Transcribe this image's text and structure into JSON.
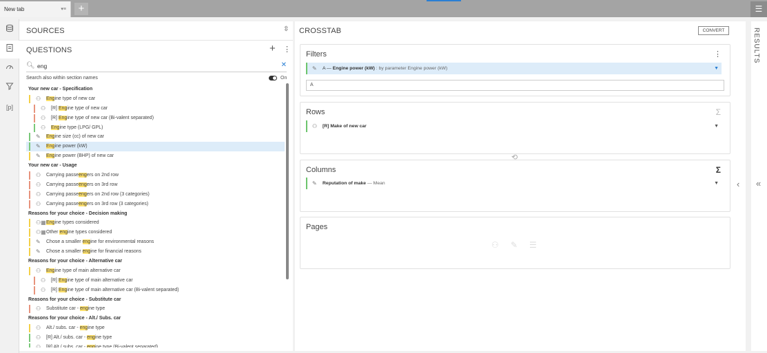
{
  "tabs": [
    {
      "label": "New tab",
      "icon": "tab-options-icon"
    }
  ],
  "new_tab_label": "+",
  "sidebar_icons": [
    "database-icon",
    "clipboard-icon",
    "gauge-icon",
    "filter-icon",
    "parameter-icon"
  ],
  "parameter_glyph": "[p]",
  "sources": {
    "title": "SOURCES"
  },
  "questions": {
    "title": "QUESTIONS",
    "search_value": "eng",
    "search_option": "Search also within section names",
    "toggle_label": "On",
    "items": [
      {
        "type": "section",
        "text": "Your new car - Specification"
      },
      {
        "indent": 1,
        "bar": "#f3d046",
        "icon": "multi",
        "pre": "",
        "hl": "Eng",
        "post": "ine type of new car"
      },
      {
        "indent": 2,
        "bar": "#e7937c",
        "icon": "multi",
        "pre": "[R] ",
        "hl": "Eng",
        "post": "ine type of new car"
      },
      {
        "indent": 2,
        "bar": "#e7937c",
        "icon": "multi",
        "pre": "[R] ",
        "hl": "Eng",
        "post": "ine type of new car (Bi-valent separated)"
      },
      {
        "indent": 2,
        "bar": "#79c879",
        "icon": "multi",
        "pre": "",
        "hl": "Eng",
        "post": "ine type (LPG/ GPL)"
      },
      {
        "indent": 1,
        "bar": "#79c879",
        "icon": "ruler",
        "pre": "",
        "hl": "Eng",
        "post": "ine size (cc) of new car"
      },
      {
        "indent": 1,
        "bar": "#79c879",
        "icon": "ruler",
        "pre": "",
        "hl": "Eng",
        "post": "ine power (kW)",
        "selected": true
      },
      {
        "indent": 1,
        "bar": "#f3d046",
        "icon": "ruler",
        "pre": "",
        "hl": "Eng",
        "post": "ine power (BHP) of new car"
      },
      {
        "type": "section",
        "text": "Your new car - Usage"
      },
      {
        "indent": 1,
        "bar": "#e7937c",
        "icon": "multi",
        "pre": "Carrying passe",
        "hl": "eng",
        "post": "ers on 2nd row"
      },
      {
        "indent": 1,
        "bar": "#e7937c",
        "icon": "multi",
        "pre": "Carrying passe",
        "hl": "eng",
        "post": "ers on 3rd row"
      },
      {
        "indent": 1,
        "bar": "#e7937c",
        "icon": "multi",
        "pre": "Carrying passe",
        "hl": "eng",
        "post": "ers on 2nd row (3 categories)"
      },
      {
        "indent": 1,
        "bar": "#e7937c",
        "icon": "multi",
        "pre": "Carrying passe",
        "hl": "eng",
        "post": "ers on 3rd row (3 categories)"
      },
      {
        "type": "section",
        "text": "Reasons for your choice - Decision making"
      },
      {
        "indent": 1,
        "bar": "#f3d046",
        "icon": "multigrid",
        "pre": "",
        "hl": "Eng",
        "post": "ine types considered"
      },
      {
        "indent": 1,
        "bar": "#f3d046",
        "icon": "multigrid",
        "pre": "Other ",
        "hl": "eng",
        "post": "ine types considered"
      },
      {
        "indent": 1,
        "bar": "#f3d046",
        "icon": "ruler",
        "pre": "Chose a smaller ",
        "hl": "eng",
        "post": "ine for environmental reasons"
      },
      {
        "indent": 1,
        "bar": "#f3d046",
        "icon": "ruler",
        "pre": "Chose a smaller ",
        "hl": "eng",
        "post": "ine for financial reasons"
      },
      {
        "type": "section",
        "text": "Reasons for your choice - Alternative car"
      },
      {
        "indent": 1,
        "bar": "#f3d046",
        "icon": "multi",
        "pre": "",
        "hl": "Eng",
        "post": "ine type of main alternative car"
      },
      {
        "indent": 2,
        "bar": "#e7937c",
        "icon": "multi",
        "pre": "[R] ",
        "hl": "Eng",
        "post": "ine type of main alternative car"
      },
      {
        "indent": 2,
        "bar": "#e7937c",
        "icon": "multi",
        "pre": "[R] ",
        "hl": "Eng",
        "post": "ine type of main alternative car (Bi-valent separated)"
      },
      {
        "type": "section",
        "text": "Reasons for your choice - Substitute car"
      },
      {
        "indent": 1,
        "bar": "#e7937c",
        "icon": "multi",
        "pre": "Substitute car - ",
        "hl": "eng",
        "post": "ine type"
      },
      {
        "type": "section",
        "text": "Reasons for your choice - Alt./ Subs. car"
      },
      {
        "indent": 1,
        "bar": "#f3d046",
        "icon": "multi",
        "pre": "Alt./ subs. car - ",
        "hl": "eng",
        "post": "ine type"
      },
      {
        "indent": 1,
        "bar": "#79c879",
        "icon": "multi",
        "pre": "[R] Alt./ subs. car - ",
        "hl": "eng",
        "post": "ine type"
      },
      {
        "indent": 1,
        "bar": "#79c879",
        "icon": "multi",
        "pre": "[R] Alt./ subs. car - ",
        "hl": "eng",
        "post": "ine type (Bi-valent separated)"
      }
    ]
  },
  "crosstab": {
    "title": "CROSSTAB",
    "convert_label": "CONVERT",
    "filters": {
      "title": "Filters",
      "item_prefix": "A — ",
      "item_name": "Engine power (kW)",
      "item_suffix": " : by parameter Engine power (kW)",
      "input_value": "A"
    },
    "rows": {
      "title": "Rows",
      "sigma": "Σ",
      "item": "[R] Make of new car"
    },
    "columns": {
      "title": "Columns",
      "sigma": "Σ",
      "item_name": "Reputation of make",
      "item_suffix": " — Mean"
    },
    "pages": {
      "title": "Pages"
    }
  },
  "results": {
    "label": "RESULTS"
  },
  "colors": {
    "accent": "#2a7fd4",
    "selected_row": "#ddecf9",
    "highlight": "#ffe16b"
  }
}
